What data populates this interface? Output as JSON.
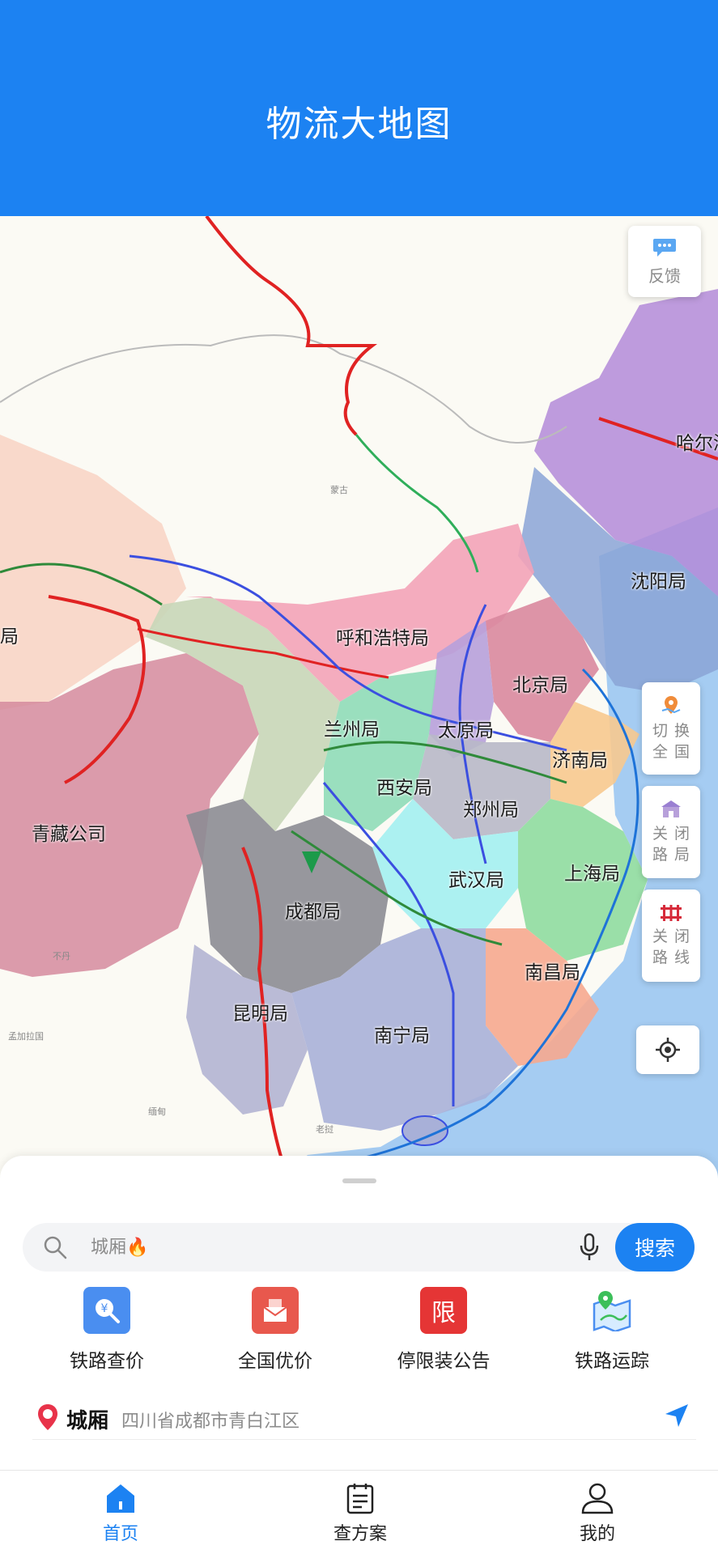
{
  "header": {
    "title": "物流大地图"
  },
  "map": {
    "regions": [
      "哈尔滨",
      "沈阳局",
      "呼和浩特局",
      "北京局",
      "兰州局",
      "太原局",
      "济南局",
      "西安局",
      "郑州局",
      "青藏公司",
      "武汉局",
      "上海局",
      "成都局",
      "南昌局",
      "昆明局",
      "南宁局",
      "局"
    ],
    "small_labels": [
      "蒙古",
      "不丹",
      "孟加拉国",
      "缅甸",
      "老挝"
    ],
    "feedback_label": "反馈",
    "switch_label": [
      "切",
      "换",
      "全",
      "国"
    ],
    "closed_office_label": [
      "关",
      "闭",
      "路",
      "局"
    ],
    "closed_line_label": [
      "关",
      "闭",
      "路",
      "线"
    ],
    "colors": {
      "harbin": "#b389d8",
      "shenyang": "#8aa3d6",
      "hohhot": "#f3a3b8",
      "beijing": "#d9889e",
      "taiyuan": "#b7a0da",
      "jinan": "#f7c98f",
      "lanzhou": "#c8d6b8",
      "xian": "#8fdcb8",
      "zhengzhou": "#b8b8c8",
      "qingzang": "#d58a9d",
      "tibet_west": "#f8d5c7",
      "wuhan": "#a8f0f0",
      "shanghai": "#8fdca0",
      "chengdu": "#8c8c94",
      "nanchang": "#f6a98f",
      "kunming": "#b3b4d3",
      "nanning": "#a8b0d8",
      "sea": "#a5ccf2",
      "rail_red": "#e02222",
      "rail_blue": "#3b4fe0",
      "rail_green": "#2f8a3a"
    }
  },
  "search": {
    "placeholder": "城厢🔥",
    "button_label": "搜索"
  },
  "quick_actions": [
    {
      "label": "铁路查价",
      "icon": "price-query-icon"
    },
    {
      "label": "全国优价",
      "icon": "discount-mail-icon"
    },
    {
      "label": "停限装公告",
      "icon": "restriction-notice-icon",
      "glyph": "限"
    },
    {
      "label": "铁路运踪",
      "icon": "rail-tracking-icon"
    }
  ],
  "location": {
    "name": "城厢",
    "address": "四川省成都市青白江区"
  },
  "tabs": [
    {
      "label": "首页",
      "active": true
    },
    {
      "label": "查方案",
      "active": false
    },
    {
      "label": "我的",
      "active": false
    }
  ]
}
